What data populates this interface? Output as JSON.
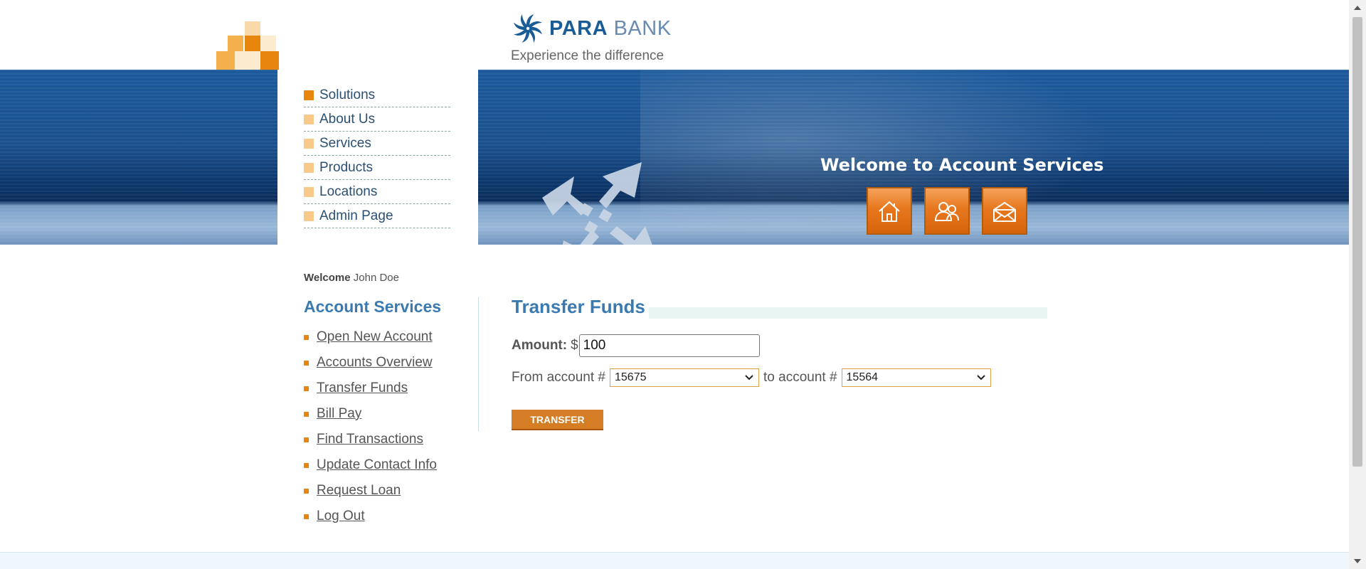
{
  "brand": {
    "name_bold": "PARA",
    "name_light": " BANK",
    "tagline": "Experience the difference"
  },
  "top_menu": {
    "items": [
      {
        "label": "Solutions",
        "active": true
      },
      {
        "label": "About Us",
        "active": false
      },
      {
        "label": "Services",
        "active": false
      },
      {
        "label": "Products",
        "active": false
      },
      {
        "label": "Locations",
        "active": false
      },
      {
        "label": "Admin Page",
        "active": false
      }
    ]
  },
  "banner": {
    "welcome_text": "Welcome to Account Services",
    "icons": [
      "home-icon",
      "contact-icon",
      "envelope-icon"
    ]
  },
  "user": {
    "welcome_label": "Welcome",
    "name": "John Doe"
  },
  "account_services": {
    "title": "Account Services",
    "links": [
      "Open New Account",
      "Accounts Overview",
      "Transfer Funds",
      "Bill Pay",
      "Find Transactions",
      "Update Contact Info",
      "Request Loan",
      "Log Out"
    ]
  },
  "transfer": {
    "title": "Transfer Funds",
    "amount_label": "Amount:",
    "currency": "$",
    "amount_value": "100",
    "from_label": "From account #",
    "from_value": "15675",
    "to_label": "to account #",
    "to_value": "15564",
    "button_label": "TRANSFER"
  },
  "colors": {
    "accent_orange": "#e8850c",
    "brand_blue": "#1a5c96",
    "heading_blue": "#3a7ab0"
  }
}
